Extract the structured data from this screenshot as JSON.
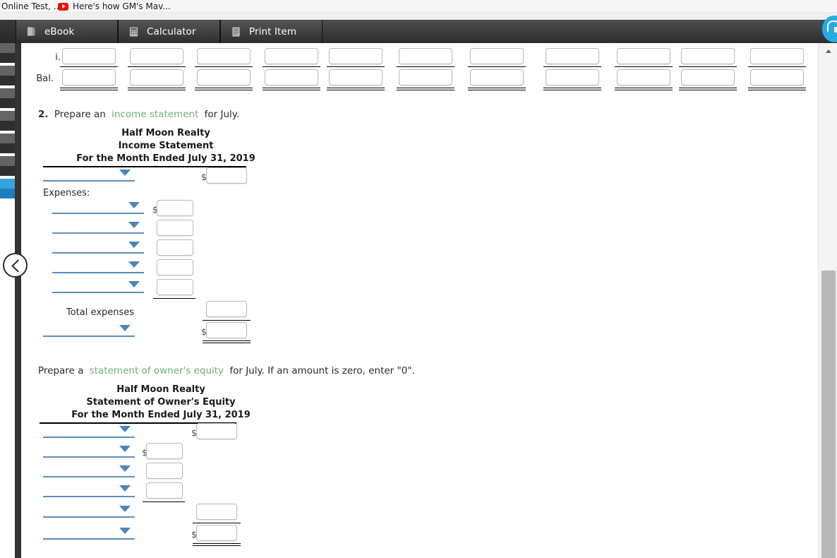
{
  "browser": {
    "bookmarks": [
      {
        "label": "Online Test, ...",
        "icon": null
      },
      {
        "label": "Here's how GM's Mav...",
        "icon": "youtube-icon"
      }
    ]
  },
  "toolbar": {
    "tabs": [
      {
        "id": "ebook",
        "label": "eBook",
        "icon": "book-icon"
      },
      {
        "id": "calculator",
        "label": "Calculator",
        "icon": "calculator-icon"
      },
      {
        "id": "print",
        "label": "Print Item",
        "icon": "document-icon"
      }
    ],
    "support_icon": "headset-icon"
  },
  "sidebar": {
    "collapse_icon": "chevron-left-icon"
  },
  "scrollbar": {
    "up_icon": "caret-up-icon"
  },
  "ledger": {
    "rows": [
      {
        "label": "i.",
        "cells": 11,
        "rule": "single"
      },
      {
        "label": "Bal.",
        "cells": 11,
        "rule": "double"
      }
    ]
  },
  "question2": {
    "number": "2.",
    "text_before": "Prepare an",
    "link": "income statement",
    "text_after": "for July."
  },
  "income_statement": {
    "title_lines": [
      "Half Moon Realty",
      "Income Statement",
      "For the Month Ended July 31, 2019"
    ],
    "revenue_row": {
      "select_placeholder": "",
      "dollar": "$"
    },
    "expenses_header": "Expenses:",
    "expense_rows": [
      {
        "dollar": "$"
      },
      {
        "dollar": ""
      },
      {
        "dollar": ""
      },
      {
        "dollar": ""
      },
      {
        "dollar": ""
      }
    ],
    "total_label": "Total expenses",
    "net_row": {
      "dollar": "$"
    }
  },
  "question3": {
    "text_before": "Prepare a",
    "link": "statement of owner's equity",
    "text_after": "for July. If an amount is zero, enter \"0\"."
  },
  "owners_equity": {
    "title_lines": [
      "Half Moon Realty",
      "Statement of Owner's Equity",
      "For the Month Ended July 31, 2019"
    ],
    "rows": [
      {
        "column": "outer",
        "dollar": "$"
      },
      {
        "column": "inner",
        "dollar": "$"
      },
      {
        "column": "inner",
        "dollar": ""
      },
      {
        "column": "inner",
        "dollar": ""
      },
      {
        "column": "outer",
        "dollar": ""
      },
      {
        "column": "outer",
        "dollar": "$"
      }
    ]
  },
  "colors": {
    "link_green": "#6fae77",
    "select_blue": "#4a86b8",
    "rail_blue": "#36a2e0",
    "tabbar_dark": "#3f3f3f",
    "support_blue": "#29abe2"
  }
}
